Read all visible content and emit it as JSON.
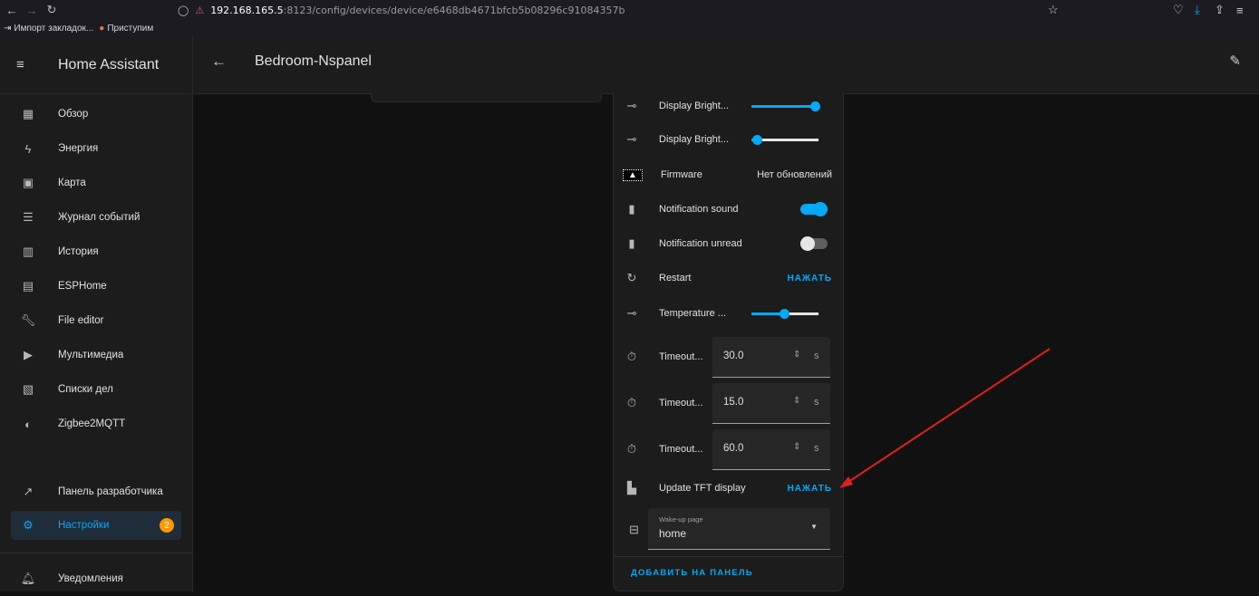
{
  "browser": {
    "url_host": "192.168.165.5",
    "url_rest": ":8123/config/devices/device/e6468db4671bfcb5b08296c91084357b",
    "bookmarks": [
      "Импорт закладок...",
      "Приступим"
    ]
  },
  "app": {
    "title": "Home Assistant",
    "page_title": "Bedroom-Nspanel"
  },
  "sidebar": {
    "items": [
      {
        "label": "Обзор",
        "icon": "dashboard-icon"
      },
      {
        "label": "Энергия",
        "icon": "lightning-icon"
      },
      {
        "label": "Карта",
        "icon": "map-icon"
      },
      {
        "label": "Журнал событий",
        "icon": "logbook-icon"
      },
      {
        "label": "История",
        "icon": "history-chart-icon"
      },
      {
        "label": "ESPHome",
        "icon": "esphome-icon"
      },
      {
        "label": "File editor",
        "icon": "wrench-icon"
      },
      {
        "label": "Мультимедиа",
        "icon": "media-icon"
      },
      {
        "label": "Списки дел",
        "icon": "clipboard-icon"
      },
      {
        "label": "Zigbee2MQTT",
        "icon": "zigbee-icon"
      }
    ],
    "developer": "Панель разработчика",
    "settings": "Настройки",
    "settings_badge": "2",
    "notifications": "Уведомления"
  },
  "entities": {
    "display_bright_1": {
      "name": "Display Bright...",
      "value_fraction": 0.95
    },
    "display_bright_2": {
      "name": "Display Bright...",
      "value_fraction": 0.08
    },
    "firmware": {
      "name": "Firmware",
      "value": "Нет обновлений"
    },
    "notification_sound": {
      "name": "Notification sound",
      "state": "on"
    },
    "notification_unread": {
      "name": "Notification unread",
      "state": "off"
    },
    "restart": {
      "name": "Restart",
      "action": "НАЖАТЬ"
    },
    "temperature": {
      "name": "Temperature ...",
      "value_fraction": 0.48
    },
    "timeout_1": {
      "name": "Timeout...",
      "value": "30.0",
      "unit": "s"
    },
    "timeout_2": {
      "name": "Timeout...",
      "value": "15.0",
      "unit": "s"
    },
    "timeout_3": {
      "name": "Timeout...",
      "value": "60.0",
      "unit": "s"
    },
    "update_tft": {
      "name": "Update TFT display",
      "action": "НАЖАТЬ"
    },
    "wakeup_page": {
      "label": "Wake-up page",
      "value": "home"
    }
  },
  "card": {
    "add_to_dashboard": "ДОБАВИТЬ НА ПАНЕЛЬ"
  },
  "colors": {
    "accent": "#03a9f4",
    "badge": "#ff9800",
    "annotation_arrow": "#e02020"
  }
}
